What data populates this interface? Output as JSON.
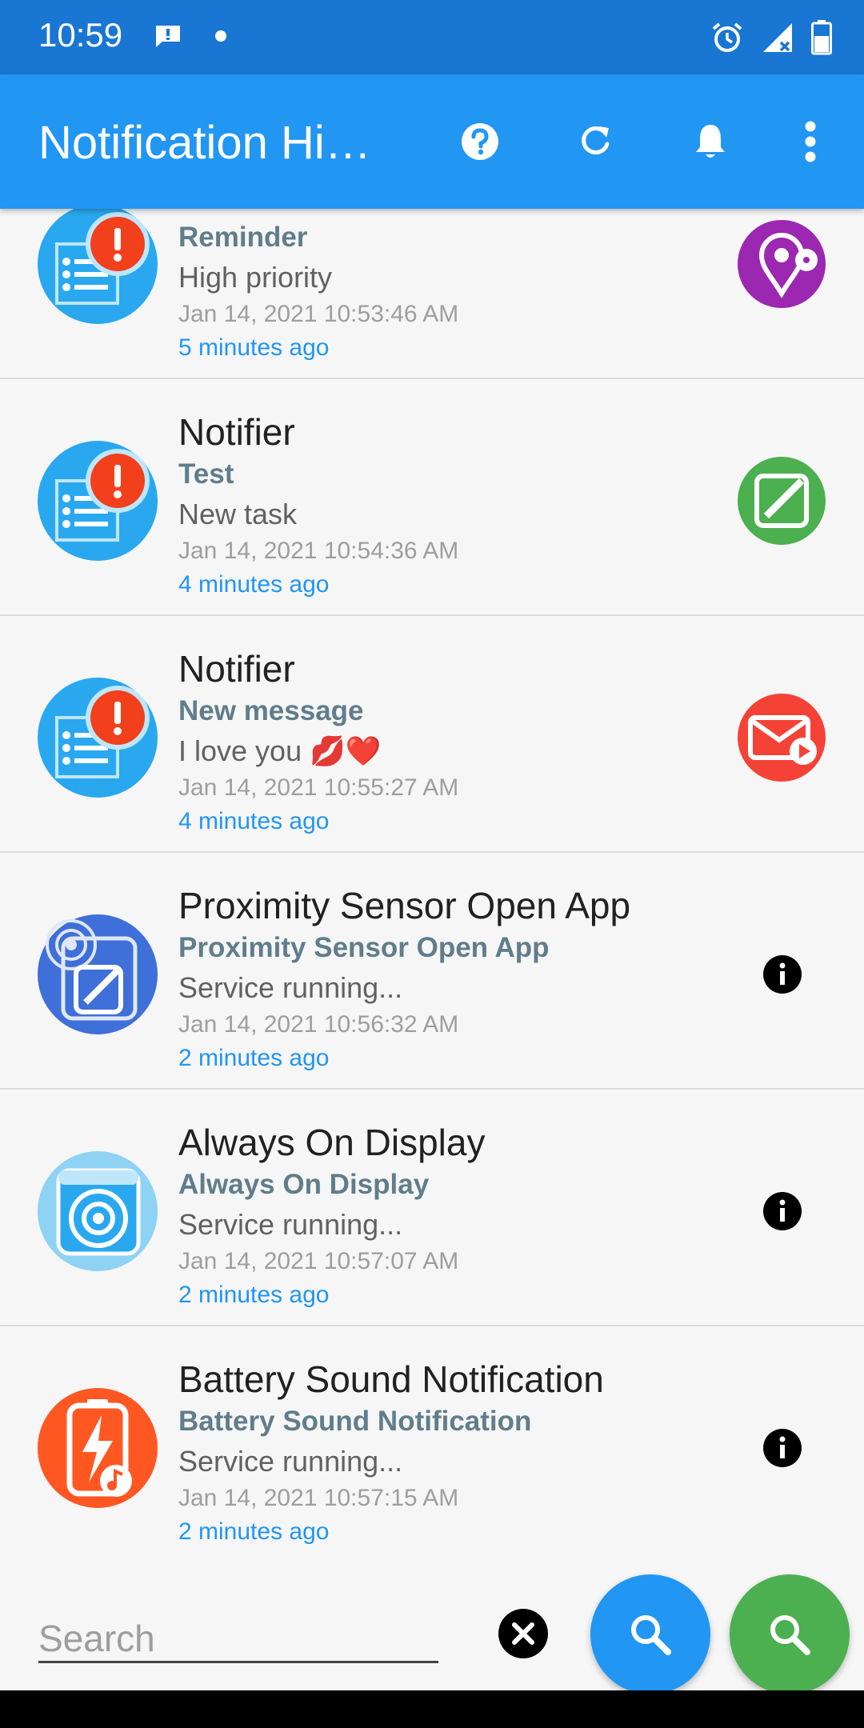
{
  "status": {
    "time": "10:59"
  },
  "appbar": {
    "title": "Notification History Log"
  },
  "colors": {
    "appbar": "#2196f3",
    "statusbar": "#1976d2",
    "ago": "#2196f3",
    "title": "#607d8b"
  },
  "items": [
    {
      "app": "",
      "title": "Reminder",
      "body": "High priority",
      "date": "Jan 14, 2021 10:53:46 AM",
      "ago": "5 minutes ago",
      "side_icon": "location-pin-icon"
    },
    {
      "app": "Notifier",
      "title": "Test",
      "body": "New task",
      "date": "Jan 14, 2021 10:54:36 AM",
      "ago": "4 minutes ago",
      "side_icon": "edit-square-icon"
    },
    {
      "app": "Notifier",
      "title": "New message",
      "body": "I love you 💋❤️",
      "date": "Jan 14, 2021 10:55:27 AM",
      "ago": "4 minutes ago",
      "side_icon": "mail-play-icon"
    },
    {
      "app": "Proximity Sensor Open App",
      "title": "Proximity Sensor Open App",
      "body": "Service running...",
      "date": "Jan 14, 2021 10:56:32 AM",
      "ago": "2 minutes ago",
      "side_icon": "info-icon"
    },
    {
      "app": "Always On Display",
      "title": "Always On Display",
      "body": "Service running...",
      "date": "Jan 14, 2021 10:57:07 AM",
      "ago": "2 minutes ago",
      "side_icon": "info-icon"
    },
    {
      "app": "Battery Sound Notification",
      "title": "Battery Sound Notification",
      "body": "Service running...",
      "date": "Jan 14, 2021 10:57:15 AM",
      "ago": "2 minutes ago",
      "side_icon": "info-icon"
    }
  ],
  "search": {
    "placeholder": "Search",
    "value": ""
  }
}
